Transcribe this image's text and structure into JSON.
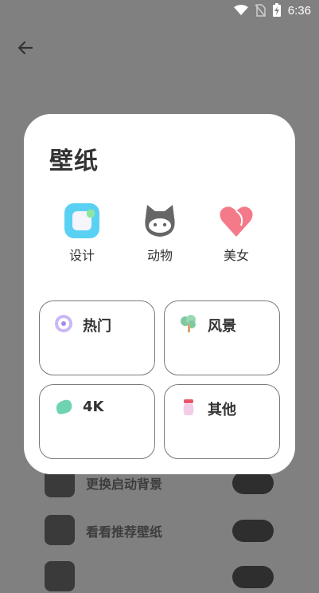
{
  "status_bar": {
    "time": "6:36"
  },
  "dialog": {
    "title": "壁纸",
    "categories": [
      {
        "label": "设计",
        "icon": "design-icon"
      },
      {
        "label": "动物",
        "icon": "cat-icon"
      },
      {
        "label": "美女",
        "icon": "heart-icon"
      }
    ],
    "tiles": [
      {
        "label": "热门",
        "icon": "disc-icon"
      },
      {
        "label": "风景",
        "icon": "tree-icon"
      },
      {
        "label": "4K",
        "icon": "bean-icon"
      },
      {
        "label": "其他",
        "icon": "jar-icon"
      }
    ]
  },
  "background_list": [
    {
      "label": "更换启动背景"
    },
    {
      "label": "看看推荐壁纸"
    }
  ],
  "colors": {
    "accent_blue": "#5ad1f2",
    "heart_pink": "#f47a8a",
    "overlay": "#808080"
  }
}
